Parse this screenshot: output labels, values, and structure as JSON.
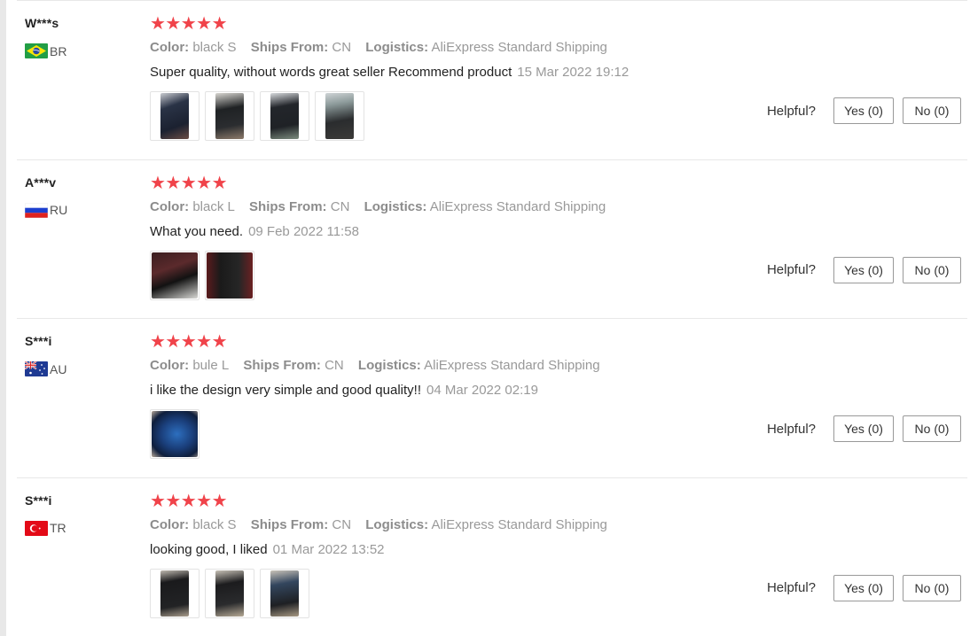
{
  "reviews": [
    {
      "user": "W***s",
      "country": "BR",
      "flag": "brazil",
      "stars": 5,
      "color_label": "Color:",
      "color_value": "black S",
      "ships_label": "Ships From:",
      "ships_value": "CN",
      "logistics_label": "Logistics:",
      "logistics_value": "AliExpress Standard Shipping",
      "comment": "Super quality, without words great seller Recommend product",
      "date": "15 Mar 2022 19:12",
      "photos": [
        "photo-1",
        "photo-2",
        "photo-3",
        "photo-4"
      ],
      "helpful_label": "Helpful?",
      "yes_label": "Yes (0)",
      "no_label": "No (0)"
    },
    {
      "user": "A***v",
      "country": "RU",
      "flag": "russia",
      "stars": 5,
      "color_label": "Color:",
      "color_value": "black L",
      "ships_label": "Ships From:",
      "ships_value": "CN",
      "logistics_label": "Logistics:",
      "logistics_value": "AliExpress Standard Shipping",
      "comment": "What you need.",
      "date": "09 Feb 2022 11:58",
      "photos": [
        "photo-1",
        "photo-2"
      ],
      "helpful_label": "Helpful?",
      "yes_label": "Yes (0)",
      "no_label": "No (0)"
    },
    {
      "user": "S***i",
      "country": "AU",
      "flag": "australia",
      "stars": 5,
      "color_label": "Color:",
      "color_value": "bule L",
      "ships_label": "Ships From:",
      "ships_value": "CN",
      "logistics_label": "Logistics:",
      "logistics_value": "AliExpress Standard Shipping",
      "comment": "i like the design very simple and good quality!!",
      "date": "04 Mar 2022 02:19",
      "photos": [
        "photo-1"
      ],
      "helpful_label": "Helpful?",
      "yes_label": "Yes (0)",
      "no_label": "No (0)"
    },
    {
      "user": "S***i",
      "country": "TR",
      "flag": "turkey",
      "stars": 5,
      "color_label": "Color:",
      "color_value": "black S",
      "ships_label": "Ships From:",
      "ships_value": "CN",
      "logistics_label": "Logistics:",
      "logistics_value": "AliExpress Standard Shipping",
      "comment": "looking good, I liked",
      "date": "01 Mar 2022 13:52",
      "photos": [
        "photo-1",
        "photo-2",
        "photo-3"
      ],
      "helpful_label": "Helpful?",
      "yes_label": "Yes (0)",
      "no_label": "No (0)"
    }
  ],
  "colors": {
    "star": "#f0434a",
    "muted_text": "#999999",
    "border": "#e8e8e8"
  }
}
